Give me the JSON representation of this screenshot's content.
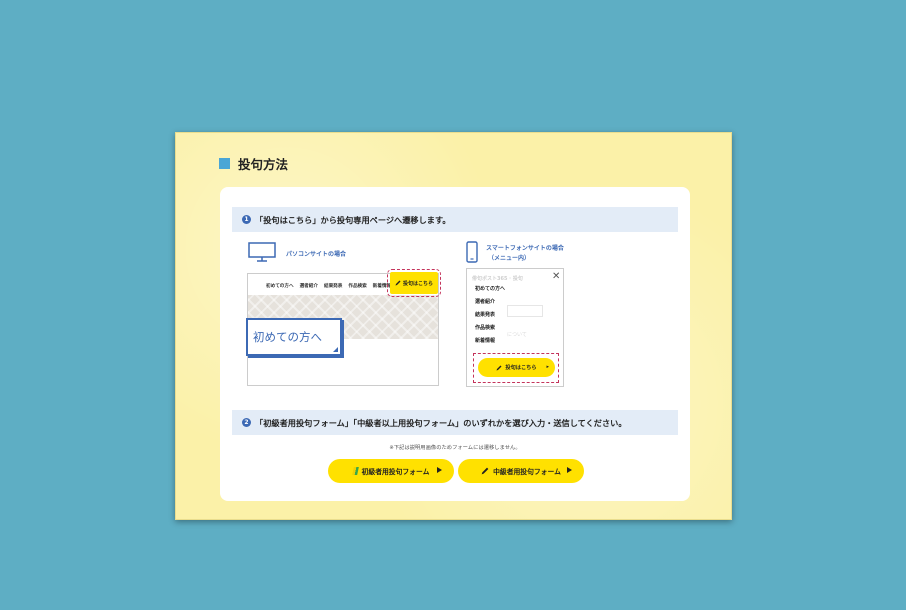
{
  "section": {
    "title": "投句方法"
  },
  "steps": [
    {
      "num": "1",
      "text": "「投句はこちら」から投句専用ページへ遷移します。"
    },
    {
      "num": "2",
      "text": "「初級者用投句フォーム」「中級者以上用投句フォーム」のいずれかを選び入力・送信してください。"
    }
  ],
  "pc": {
    "label": "パソコンサイトの場合",
    "nav": [
      "初めての方へ",
      "選者紹介",
      "結果発表",
      "作品検索",
      "新着情報"
    ],
    "post_button": "投句はこちら",
    "hero_text": "初めての方へ"
  },
  "sp": {
    "label_line1": "スマートフォンサイトの場合",
    "label_line2": "（メニュー内）",
    "ghost_text": "俳句ポスト365 · 投句",
    "ghost_text2": "について",
    "close_glyph": "✕",
    "menu": [
      "初めての方へ",
      "選者紹介",
      "結果発表",
      "作品検索",
      "新着情報"
    ],
    "post_button": "投句はこちら",
    "arrow_glyph": "▸"
  },
  "note": "※下記は説明用画像のためフォームには遷移しません。",
  "form_buttons": {
    "beginner": "初級者用投句フォーム",
    "intermediate": "中級者用投句フォーム"
  },
  "colors": {
    "background": "#5eaec4",
    "panel": "#fbf1a8",
    "accent_blue": "#3c69b4",
    "button_yellow": "#ffe100",
    "dashed_red": "#c4335b"
  }
}
